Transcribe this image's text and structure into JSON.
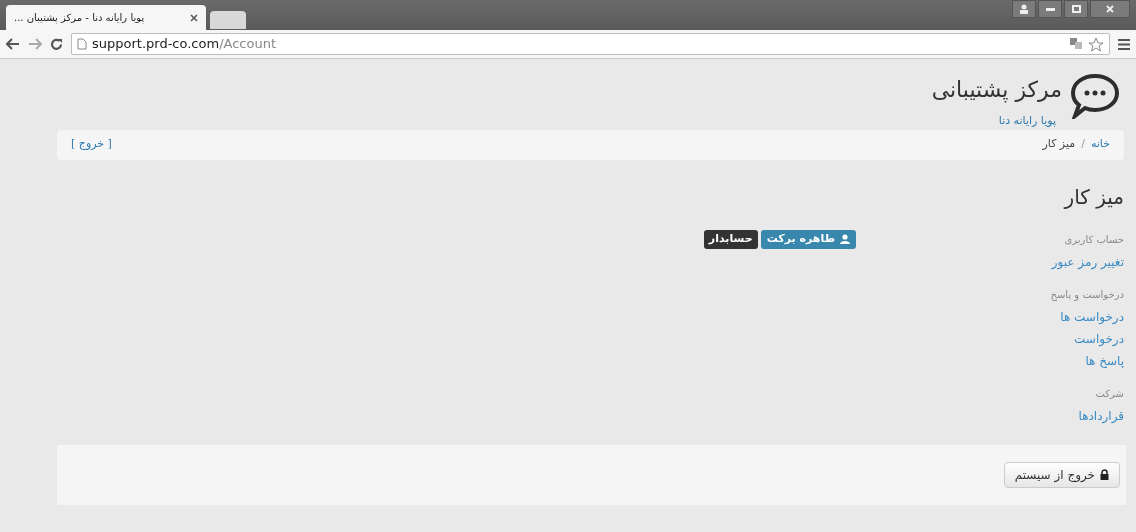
{
  "browser": {
    "tab_title": "پویا رایانه دنا - مرکز پشتیبان ...",
    "url_host": "support.prd-co.com",
    "url_path": "/Account"
  },
  "header": {
    "title": "مرکز پشتیبانی",
    "subtitle": "پویا رایانه دنا"
  },
  "breadcrumb": {
    "items": [
      {
        "label": "خانه",
        "selected": false
      },
      {
        "label": "میز کار",
        "selected": true
      }
    ],
    "separator": "/",
    "logout": "[ خروج ]"
  },
  "heading": "میز کار",
  "sidebar": [
    {
      "kind": "header",
      "label": "حساب کاربری"
    },
    {
      "kind": "link",
      "label": "تغییر رمز عبور"
    },
    {
      "kind": "header",
      "label": "درخواست و پاسخ"
    },
    {
      "kind": "link",
      "label": "درخواست ها"
    },
    {
      "kind": "link",
      "label": "درخواست"
    },
    {
      "kind": "link",
      "label": "پاسخ ها"
    },
    {
      "kind": "header",
      "label": "شرکت"
    },
    {
      "kind": "link",
      "label": "قراردادها"
    }
  ],
  "user": {
    "name": "طاهره برکت",
    "role": "حسابدار"
  },
  "footer": {
    "button": "خروج از سیستم"
  }
}
